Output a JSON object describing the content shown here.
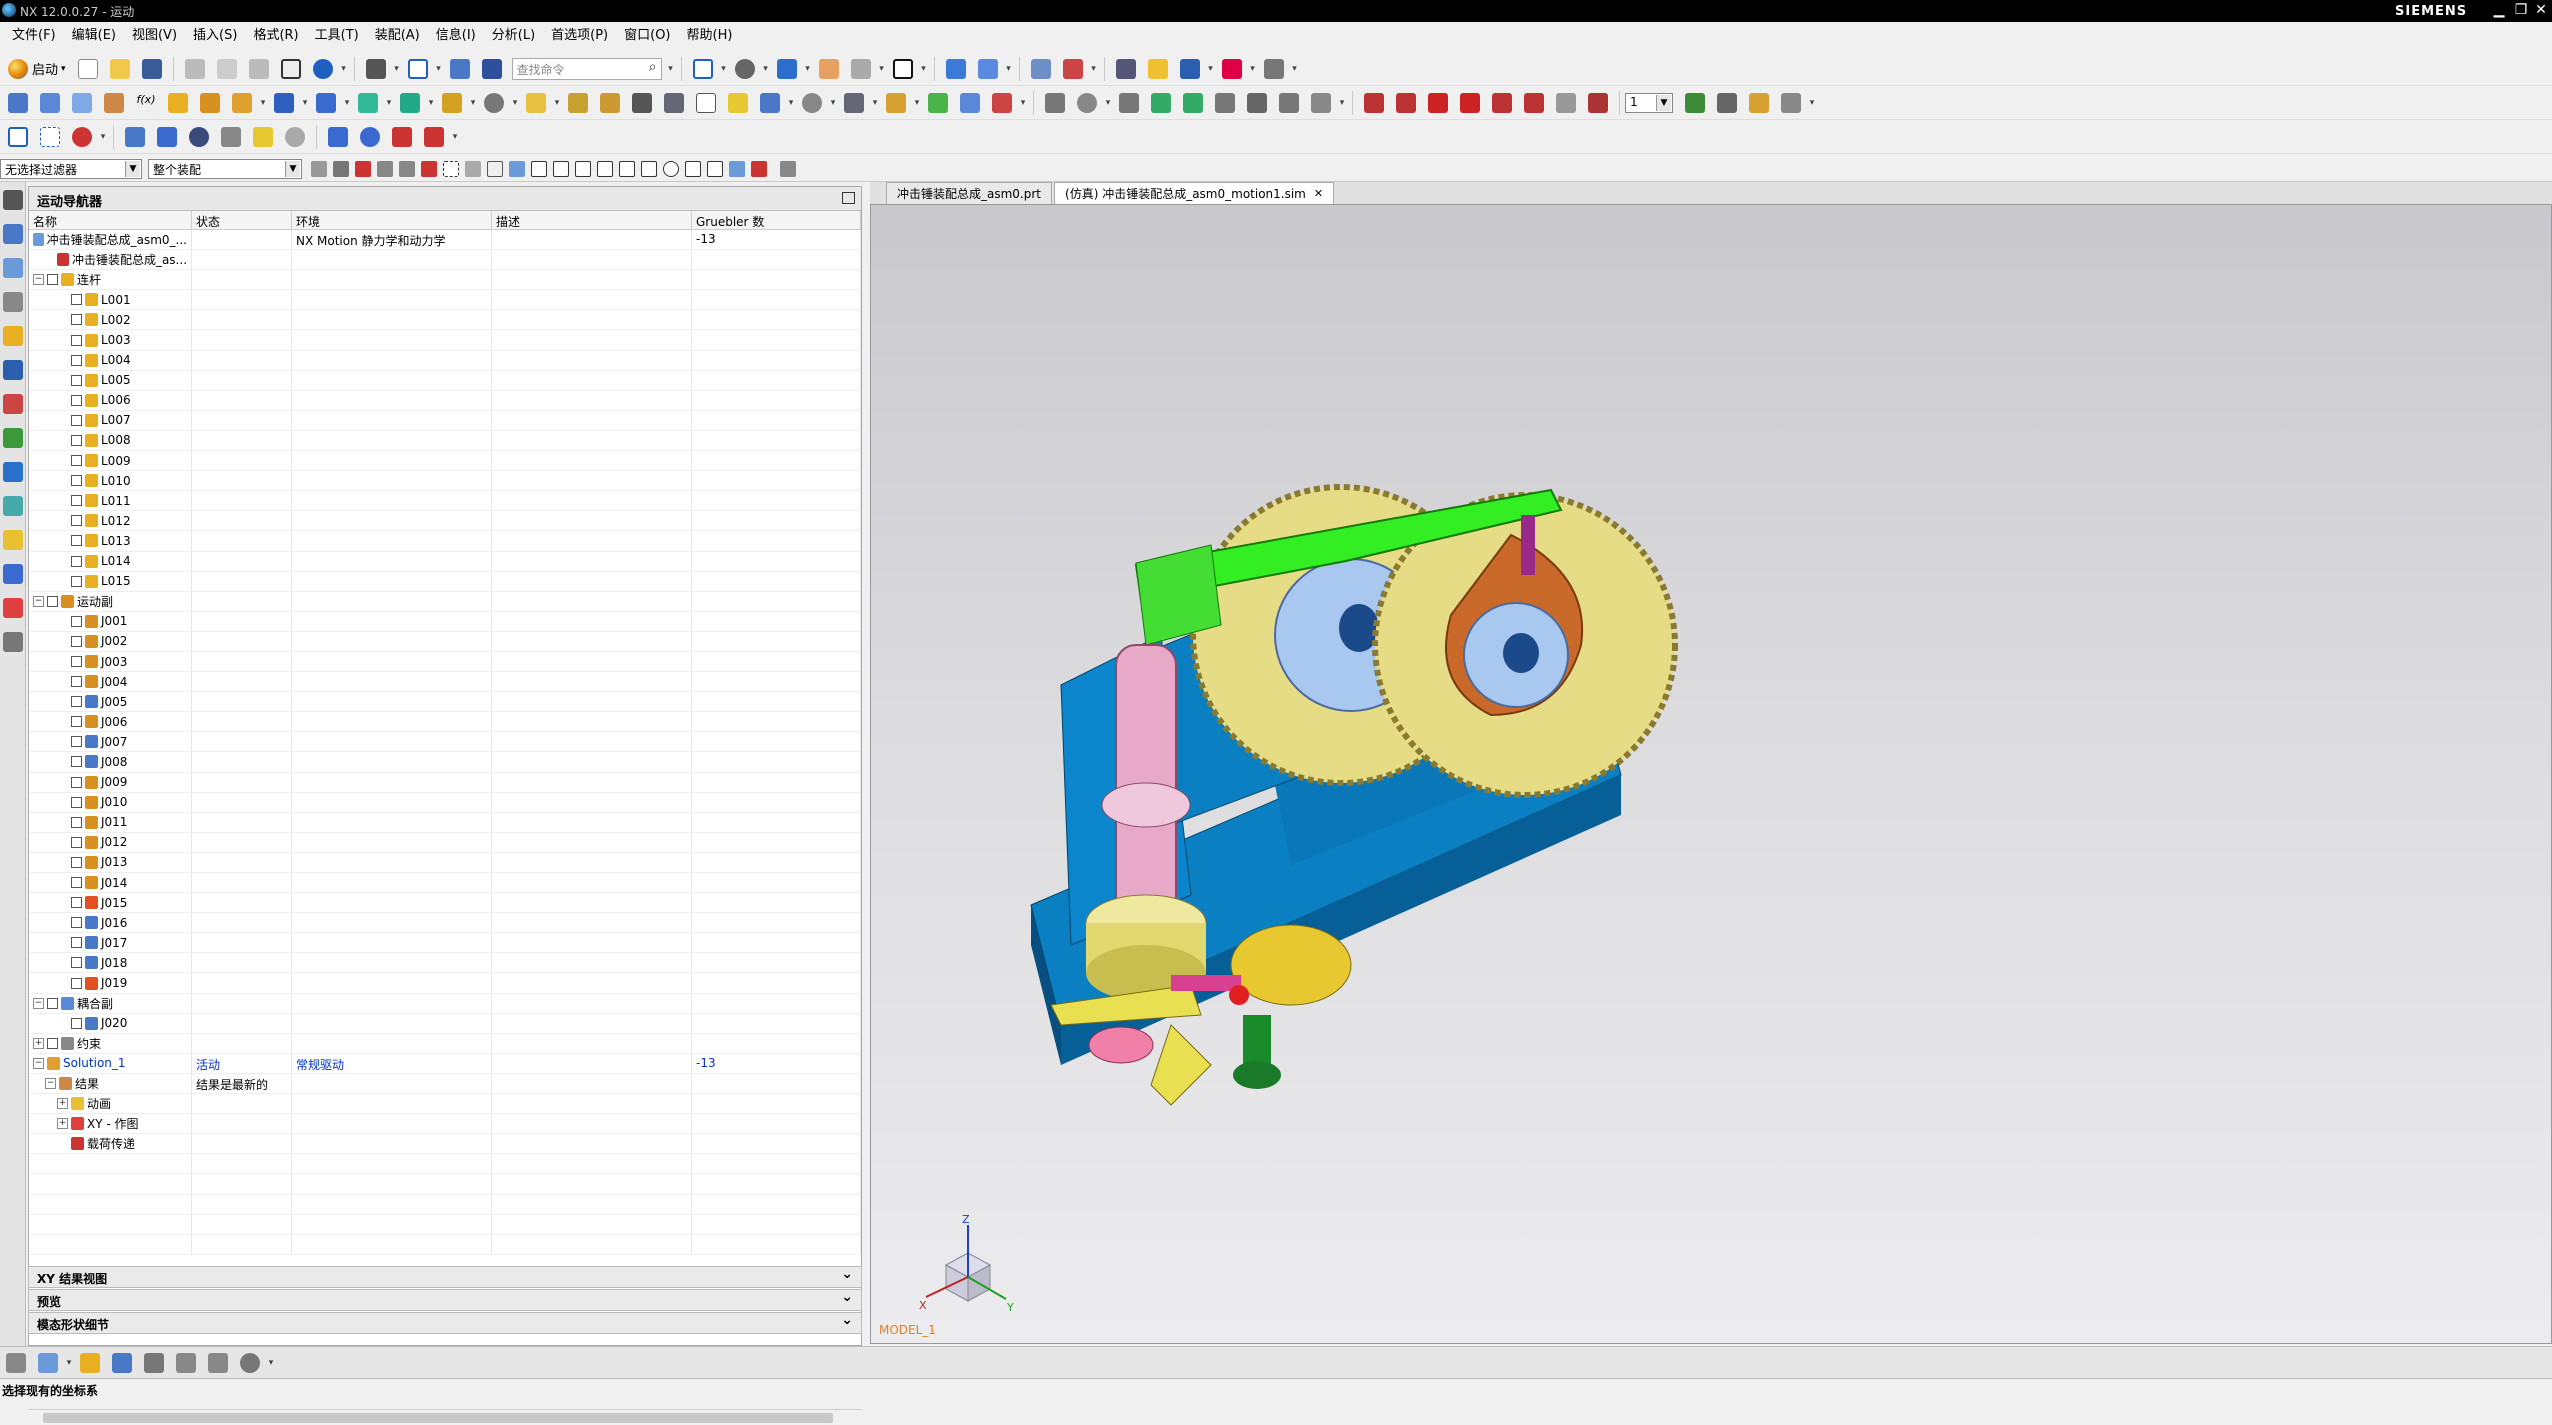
{
  "window": {
    "title": "NX 12.0.0.27 - 运动",
    "brand": "SIEMENS",
    "minimize": "▁",
    "restore": "❐",
    "close": "✕"
  },
  "menu": [
    "文件(F)",
    "编辑(E)",
    "视图(V)",
    "插入(S)",
    "格式(R)",
    "工具(T)",
    "装配(A)",
    "信息(I)",
    "分析(L)",
    "首选项(P)",
    "窗口(O)",
    "帮助(H)"
  ],
  "toolbar": {
    "start_label": "启动",
    "command_search_placeholder": "查找命令",
    "animation_step_value": "1"
  },
  "filterbar": {
    "selection_filter": "无选择过滤器",
    "scope": "整个装配"
  },
  "navigator": {
    "title": "运动导航器",
    "columns": [
      "名称",
      "状态",
      "环境",
      "描述",
      "Gruebler 数"
    ],
    "rows": [
      {
        "name": "冲击锤装配总成_asm0_...",
        "status": "",
        "env": "NX Motion 静力学和动力学",
        "desc": "",
        "gruebler": "-13",
        "level": 0,
        "exp": "",
        "icon": "sim"
      },
      {
        "name": "冲击锤装配总成_as...",
        "status": "",
        "env": "",
        "desc": "",
        "gruebler": "",
        "level": 1,
        "exp": "",
        "icon": "asm"
      },
      {
        "name": "连杆",
        "status": "",
        "env": "",
        "desc": "",
        "gruebler": "",
        "level": 0,
        "exp": "−",
        "chk": true,
        "icon": "link"
      },
      {
        "name": "L001",
        "level": 2,
        "chk": true,
        "icon": "link"
      },
      {
        "name": "L002",
        "level": 2,
        "chk": true,
        "icon": "link"
      },
      {
        "name": "L003",
        "level": 2,
        "chk": true,
        "icon": "link"
      },
      {
        "name": "L004",
        "level": 2,
        "chk": true,
        "icon": "link"
      },
      {
        "name": "L005",
        "level": 2,
        "chk": true,
        "icon": "link"
      },
      {
        "name": "L006",
        "level": 2,
        "chk": true,
        "icon": "link"
      },
      {
        "name": "L007",
        "level": 2,
        "chk": true,
        "icon": "link"
      },
      {
        "name": "L008",
        "level": 2,
        "chk": true,
        "icon": "link"
      },
      {
        "name": "L009",
        "level": 2,
        "chk": true,
        "icon": "link"
      },
      {
        "name": "L010",
        "level": 2,
        "chk": true,
        "icon": "link"
      },
      {
        "name": "L011",
        "level": 2,
        "chk": true,
        "icon": "link"
      },
      {
        "name": "L012",
        "level": 2,
        "chk": true,
        "icon": "link"
      },
      {
        "name": "L013",
        "level": 2,
        "chk": true,
        "icon": "link"
      },
      {
        "name": "L014",
        "level": 2,
        "chk": true,
        "icon": "link"
      },
      {
        "name": "L015",
        "level": 2,
        "chk": true,
        "icon": "link"
      },
      {
        "name": "运动副",
        "level": 0,
        "exp": "−",
        "chk": true,
        "icon": "joint"
      },
      {
        "name": "J001",
        "level": 2,
        "chk": true,
        "icon": "joint"
      },
      {
        "name": "J002",
        "level": 2,
        "chk": true,
        "icon": "joint"
      },
      {
        "name": "J003",
        "level": 2,
        "chk": true,
        "icon": "joint"
      },
      {
        "name": "J004",
        "level": 2,
        "chk": true,
        "icon": "joint"
      },
      {
        "name": "J005",
        "level": 2,
        "chk": true,
        "icon": "joint2"
      },
      {
        "name": "J006",
        "level": 2,
        "chk": true,
        "icon": "joint"
      },
      {
        "name": "J007",
        "level": 2,
        "chk": true,
        "icon": "joint2"
      },
      {
        "name": "J008",
        "level": 2,
        "chk": true,
        "icon": "joint2"
      },
      {
        "name": "J009",
        "level": 2,
        "chk": true,
        "icon": "joint"
      },
      {
        "name": "J010",
        "level": 2,
        "chk": true,
        "icon": "joint"
      },
      {
        "name": "J011",
        "level": 2,
        "chk": true,
        "icon": "joint"
      },
      {
        "name": "J012",
        "level": 2,
        "chk": true,
        "icon": "joint"
      },
      {
        "name": "J013",
        "level": 2,
        "chk": true,
        "icon": "joint"
      },
      {
        "name": "J014",
        "level": 2,
        "chk": true,
        "icon": "joint"
      },
      {
        "name": "J015",
        "level": 2,
        "chk": true,
        "icon": "joint3"
      },
      {
        "name": "J016",
        "level": 2,
        "chk": true,
        "icon": "joint2"
      },
      {
        "name": "J017",
        "level": 2,
        "chk": true,
        "icon": "joint2"
      },
      {
        "name": "J018",
        "level": 2,
        "chk": true,
        "icon": "joint2"
      },
      {
        "name": "J019",
        "level": 2,
        "chk": true,
        "icon": "joint3"
      },
      {
        "name": "耦合副",
        "level": 0,
        "exp": "−",
        "chk": true,
        "icon": "couple"
      },
      {
        "name": "J020",
        "level": 2,
        "chk": true,
        "icon": "joint2"
      },
      {
        "name": "约束",
        "level": 0,
        "exp": "+",
        "chk": true,
        "icon": "constraint"
      },
      {
        "name": "Solution_1",
        "status": "活动",
        "env": "常规驱动",
        "desc": "",
        "gruebler": "-13",
        "level": 0,
        "exp": "−",
        "icon": "solution",
        "blue": true
      },
      {
        "name": "结果",
        "status": "结果是最新的",
        "level": 1,
        "exp": "−",
        "icon": "result"
      },
      {
        "name": "动画",
        "level": 2,
        "exp": "+",
        "icon": "anim"
      },
      {
        "name": "XY - 作图",
        "level": 2,
        "exp": "+",
        "icon": "xy"
      },
      {
        "name": "载荷传递",
        "level": 2,
        "icon": "load"
      }
    ],
    "sections": [
      "XY 结果视图",
      "预览",
      "模态形状细节"
    ]
  },
  "tabs": [
    {
      "label": "冲击锤装配总成_asm0.prt",
      "active": false
    },
    {
      "label": "(仿真) 冲击锤装配总成_asm0_motion1.sim",
      "active": true
    }
  ],
  "viewport": {
    "view_name": "MODEL_1",
    "triad": {
      "x": "X",
      "y": "Y",
      "z": "Z"
    }
  },
  "status": {
    "message": "选择现有的坐标系"
  },
  "colors": {
    "base": "#0a7fc2",
    "gear": "#e7dc86",
    "arm": "#33ee22",
    "pink": "#e8a8c8",
    "orange_cam": "#c96a2a",
    "disc": "#a8c8f0"
  }
}
